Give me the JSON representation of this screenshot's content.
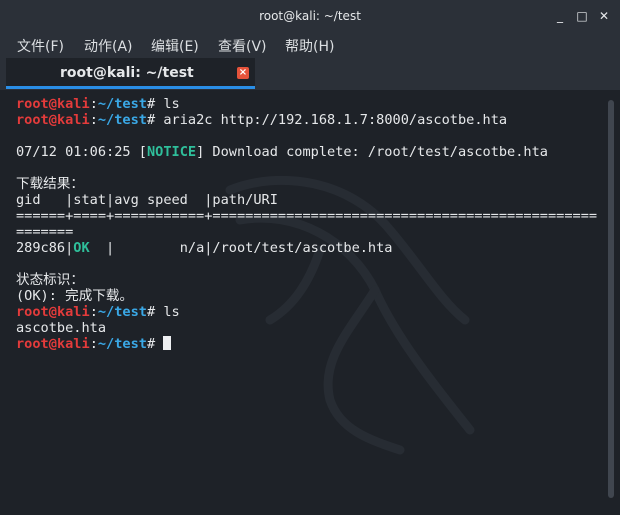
{
  "window": {
    "title": "root@kali: ~/test",
    "controls": {
      "minimize": "_",
      "maximize": "□",
      "close": "✕"
    }
  },
  "menubar": {
    "items": [
      "文件(F)",
      "动作(A)",
      "编辑(E)",
      "查看(V)",
      "帮助(H)"
    ]
  },
  "tab": {
    "label": "root@kali: ~/test",
    "close": "×"
  },
  "prompt": {
    "user": "root",
    "at": "@",
    "host": "kali",
    "colon": ":",
    "path": "~/test",
    "symbol": "# "
  },
  "terminal": {
    "cmd1": "ls",
    "cmd2": "aria2c http://192.168.1.7:8000/ascotbe.hta",
    "notice_time": "07/12 01:06:25 ",
    "notice_open": "[",
    "notice_tag": "NOTICE",
    "notice_rest": "] Download complete: /root/test/ascotbe.hta",
    "result_heading": "下载结果：",
    "table_header": "gid   |stat|avg speed  |path/URI",
    "sep1": "======+====+===========+===============================================",
    "sep2": "=======",
    "row_gid": "289c86",
    "row_bar": "|",
    "row_stat": "OK",
    "row_rest": "  |        n/a|/root/test/ascotbe.hta",
    "legend_heading": "状态标识：",
    "legend_ok": "(OK): 完成下载。",
    "cmd3": "ls",
    "output3": "ascotbe.hta"
  },
  "colors": {
    "prompt_user": "#e33b3b",
    "prompt_path": "#3aa8e6",
    "ok": "#2fbf9b",
    "tab_underline": "#2a8ee6"
  }
}
